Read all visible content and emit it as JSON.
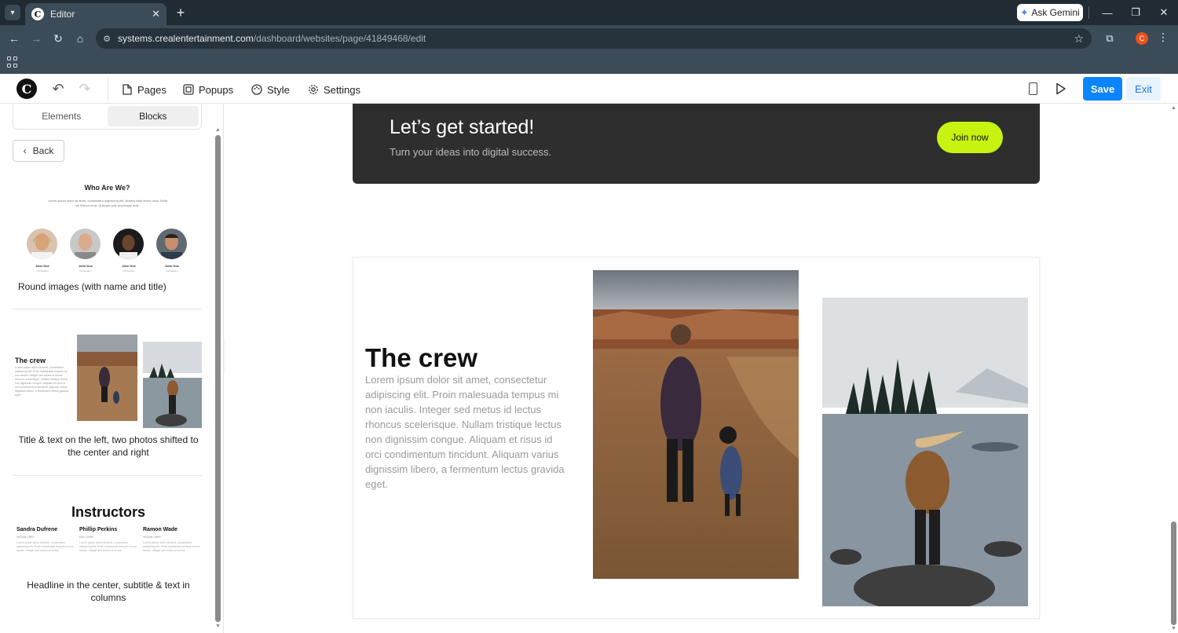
{
  "browser": {
    "tab_title": "Editor",
    "gemini_label": "Ask Gemini",
    "url_domain": "systems.crealentertainment.com",
    "url_path": "/dashboard/websites/page/41849468/edit",
    "profile_initial": "C"
  },
  "editor_bar": {
    "menu": [
      {
        "label": "Pages",
        "icon": "page-icon"
      },
      {
        "label": "Popups",
        "icon": "popup-icon"
      },
      {
        "label": "Style",
        "icon": "palette-icon"
      },
      {
        "label": "Settings",
        "icon": "gear-icon"
      }
    ],
    "save_label": "Save",
    "exit_label": "Exit"
  },
  "sidebar": {
    "tabs": [
      {
        "label": "Elements",
        "active": false
      },
      {
        "label": "Blocks",
        "active": true
      }
    ],
    "back_label": "Back",
    "blocks": [
      {
        "caption": "Round images (with name and title)",
        "preview_title": "Who Are We?",
        "preview_text": "Lorem ipsum dolor sit amet, consectetur adipiscing elit. Nullam vitae libero risus. Nulla vel finibus urna. Quisque quis accumsan ante.",
        "people": [
          {
            "name": "Jane Doe",
            "role": "Occupation"
          },
          {
            "name": "John Doe",
            "role": "Occupation"
          },
          {
            "name": "Jane Doe",
            "role": "Occupation"
          },
          {
            "name": "John Doe",
            "role": "Occupation"
          }
        ]
      },
      {
        "caption": "Title & text on the left, two photos shifted to the center and right",
        "preview_title": "The crew",
        "preview_text": "Lorem ipsum dolor sit amet, consectetur adipiscing elit. Proin malesuada tempus mi non iaculis. Integer sed metus id lectus rhoncus scelerisque. Nullam tristique lectus non dignissim congue. Aliquam et risus id orci condimentum tincidunt. Aliquam varius dignissim libero, a fermentum lectus gravida eget."
      },
      {
        "caption": "Headline in the center, subtitle & text in columns",
        "preview_title": "Instructors",
        "columns": [
          {
            "name": "Sandra Dufrene",
            "role": "VEGAN CHEF",
            "text": "Lorem ipsum dolor sit amet, consectetur adipiscing elit. Proin malesuada tempus mi non iaculis. Integer sed metus id lectus."
          },
          {
            "name": "Phillip Perkins",
            "role": "DELI CHEF",
            "text": "Lorem ipsum dolor sit amet, consectetur adipiscing elit. Proin malesuada tempus mi non iaculis. Integer sed metus id lectus."
          },
          {
            "name": "Ramon Wade",
            "role": "VEGAN CHEF",
            "text": "Lorem ipsum dolor sit amet, consectetur adipiscing elit. Proin malesuada tempus mi non iaculis. Integer sed metus id lectus."
          }
        ]
      }
    ]
  },
  "canvas": {
    "cta": {
      "title": "Let’s get started!",
      "subtitle": "Turn your ideas into digital success.",
      "button": "Join now"
    },
    "crew": {
      "title": "The crew",
      "text": "Lorem ipsum dolor sit amet, consectetur adipiscing elit. Proin malesuada tempus mi non iaculis. Integer sed metus id lectus rhoncus scelerisque. Nullam tristique lectus non dignissim congue. Aliquam et risus id orci condimentum tincidunt. Aliquam varius dignissim libero, a fermentum lectus gravida eget."
    }
  },
  "colors": {
    "save": "#0a84ff",
    "cta_button": "#c6f30f",
    "cta_bg": "#2e2e2e"
  }
}
